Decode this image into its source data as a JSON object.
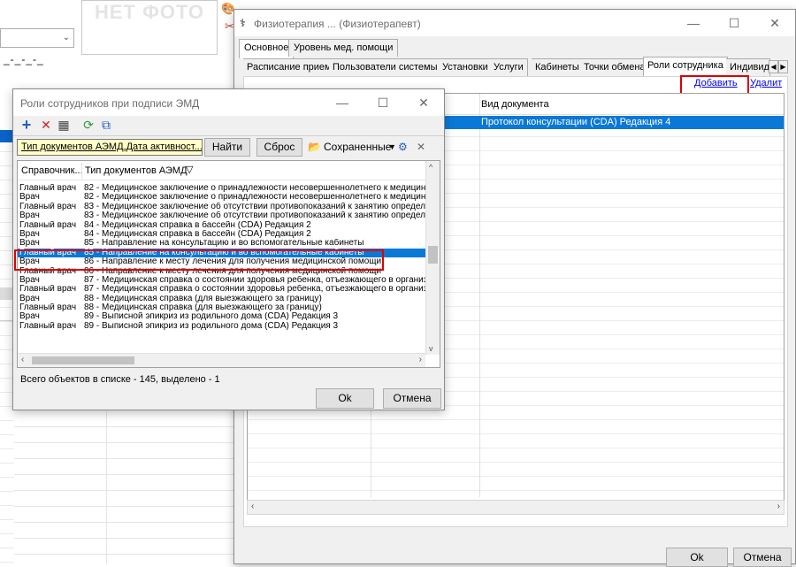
{
  "background": {
    "photo_placeholder": "НЕТ ФОТО",
    "dashes": "_-_-_-_"
  },
  "main_window": {
    "title": "Физиотерапия ... (Физиотерапевт)",
    "tabs_top": [
      "Основное",
      "Уровень мед. помощи"
    ],
    "tabs_second": [
      "Расписание приема",
      "Пользователи системы",
      "Установки",
      "Услуги",
      "Кабинеты",
      "Точки обмена",
      "Роли сотрудника",
      "Индивид"
    ],
    "active_tab_second": "Роли сотрудника",
    "add_link": "Добавить",
    "delete_link": "Удалить",
    "grid_header": "Вид документа",
    "grid_selected_row": "Протокол консультации (CDA) Редакция 4",
    "ok_button": "Ok",
    "cancel_button": "Отмена"
  },
  "dialog": {
    "title": "Роли сотрудников при подписи ЭМД",
    "filter_text": "Тип документов АЭМД,Дата активност...",
    "find_button": "Найти",
    "reset_button": "Сброс",
    "saved_label": "Сохраненные",
    "col_role": "Справочник...",
    "col_doctype": "Тип документов АЭМД",
    "rows": [
      {
        "role": "Главный врач",
        "doc": "82 - Медицинское заключение о принадлежности несовершеннолетнего к медицинск"
      },
      {
        "role": "Врач",
        "doc": "82 - Медицинское заключение о принадлежности несовершеннолетнего к медицинск"
      },
      {
        "role": "Главный врач",
        "doc": "83 - Медицинское заключение об отсутствии противопоказаний к занятию определе"
      },
      {
        "role": "Врач",
        "doc": "83 - Медицинское заключение об отсутствии противопоказаний к занятию определе"
      },
      {
        "role": "Главный врач",
        "doc": "84 - Медицинская справка в бассейн (CDA) Редакция 2"
      },
      {
        "role": "Врач",
        "doc": "84 - Медицинская справка в бассейн (CDA) Редакция 2"
      },
      {
        "role": "Врач",
        "doc": "85 - Направление на консультацию и во вспомогательные кабинеты"
      },
      {
        "role": "Главный врач",
        "doc": "85 - Направление на консультацию и во вспомогательные кабинеты"
      },
      {
        "role": "Врач",
        "doc": "86 - Направление к месту лечения для получения медицинской помощи"
      },
      {
        "role": "Главный врач",
        "doc": "86 - Направление к месту лечения для получения медицинской помощи"
      },
      {
        "role": "Врач",
        "doc": "87 - Медицинская справка о состоянии здоровья ребенка, отъезжающего в организ"
      },
      {
        "role": "Главный врач",
        "doc": "87 - Медицинская справка о состоянии здоровья ребенка, отъезжающего в организ"
      },
      {
        "role": "Врач",
        "doc": "88 - Медицинская справка (для выезжающего за границу)"
      },
      {
        "role": "Главный врач",
        "doc": "88 - Медицинская справка (для выезжающего за границу)"
      },
      {
        "role": "Врач",
        "doc": "89 - Выписной эпикриз из родильного дома (CDA) Редакция 3"
      },
      {
        "role": "Главный врач",
        "doc": "89 - Выписной эпикриз из родильного дома (CDA) Редакция 3"
      }
    ],
    "selected_row_index": 7,
    "status": "Всего объектов в списке - 145, выделено - 1",
    "ok_button": "Ok",
    "cancel_button": "Отмена"
  }
}
